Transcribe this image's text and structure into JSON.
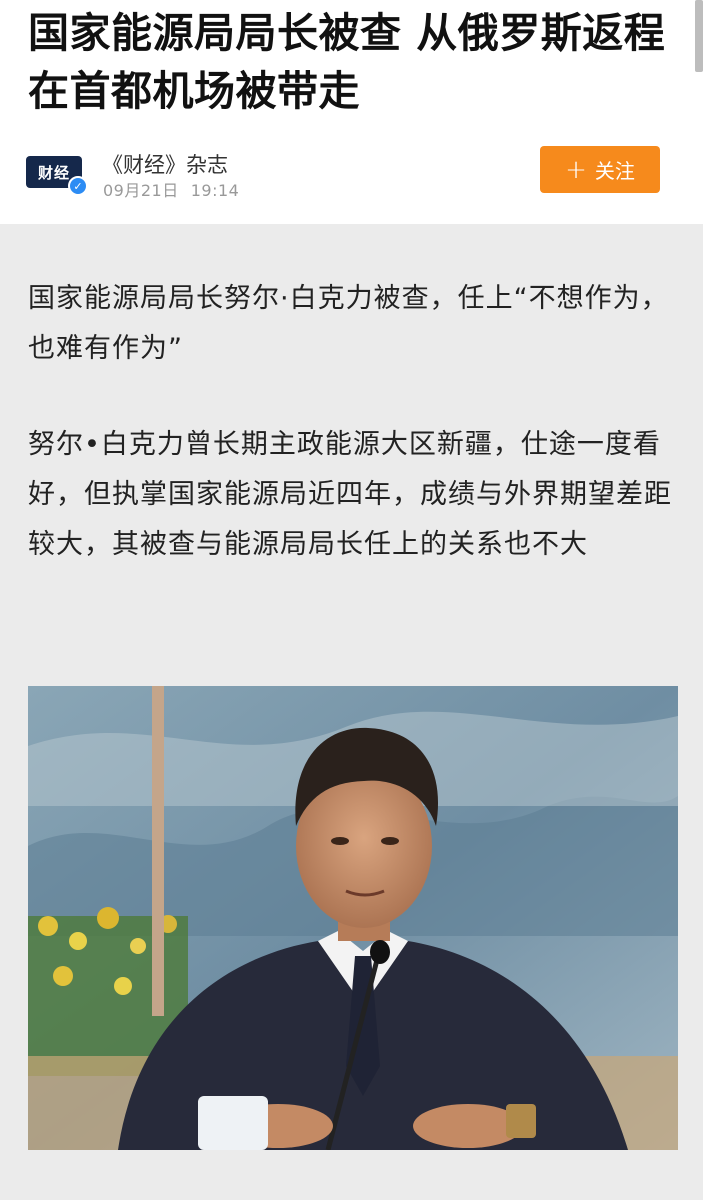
{
  "article": {
    "headline": "国家能源局局长被查 从俄罗斯返程在首都机场被带走",
    "source": {
      "name": "《财经》杂志",
      "date": "09月21日",
      "time": "19:14",
      "logo_text": "财经",
      "verified_icon": "check-badge-icon"
    },
    "follow_button": {
      "icon": "plus-icon",
      "label": "关注"
    },
    "paragraphs": [
      "国家能源局局长努尔·白克力被查，任上“不想作为，也难有作为”",
      "努尔•白克力曾长期主政能源大区新疆，仕途一度看好，但执掌国家能源局近四年，成绩与外界期望差距较大，其被查与能源局局长任上的关系也不大"
    ]
  },
  "colors": {
    "accent_orange": "#f68a1c",
    "verified_blue": "#2c8cf4",
    "page_background": "#ebebeb"
  }
}
